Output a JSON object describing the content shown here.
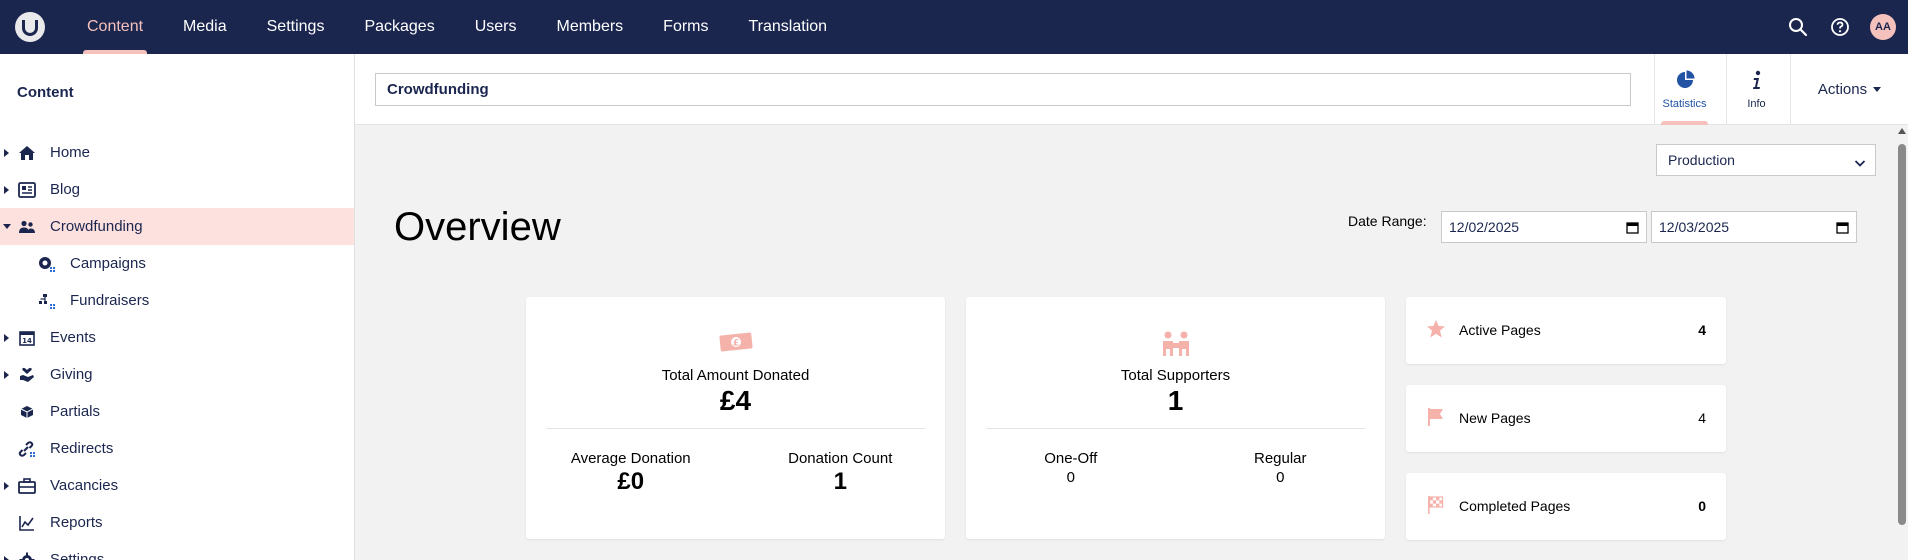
{
  "topbar": {
    "logo": "umbraco-logo",
    "nav": [
      {
        "label": "Content",
        "active": true
      },
      {
        "label": "Media"
      },
      {
        "label": "Settings"
      },
      {
        "label": "Packages"
      },
      {
        "label": "Users"
      },
      {
        "label": "Members"
      },
      {
        "label": "Forms"
      },
      {
        "label": "Translation"
      }
    ],
    "icons": [
      "search-icon",
      "help-icon"
    ],
    "avatar_initials": "AA"
  },
  "sidebar": {
    "title": "Content",
    "items": [
      {
        "label": "Home",
        "icon": "home-icon",
        "caret": "closed"
      },
      {
        "label": "Blog",
        "icon": "newspaper-icon",
        "caret": "closed"
      },
      {
        "label": "Crowdfunding",
        "icon": "people-icon",
        "caret": "open",
        "selected": true
      },
      {
        "label": "Campaigns",
        "icon": "campaign-icon",
        "child": true
      },
      {
        "label": "Fundraisers",
        "icon": "sitemap-icon",
        "child": true
      },
      {
        "label": "Events",
        "icon": "calendar-icon",
        "caret": "closed"
      },
      {
        "label": "Giving",
        "icon": "hand-heart-icon",
        "caret": "closed"
      },
      {
        "label": "Partials",
        "icon": "box-icon"
      },
      {
        "label": "Redirects",
        "icon": "link-icon"
      },
      {
        "label": "Vacancies",
        "icon": "briefcase-icon",
        "caret": "closed"
      },
      {
        "label": "Reports",
        "icon": "chart-icon"
      },
      {
        "label": "Settings",
        "icon": "gear-icon",
        "caret": "closed"
      }
    ]
  },
  "header": {
    "name_value": "Crowdfunding",
    "tabs": [
      {
        "label": "Statistics",
        "icon": "pie-chart-icon",
        "active": true
      },
      {
        "label": "Info",
        "icon": "info-icon"
      }
    ],
    "actions_label": "Actions"
  },
  "main": {
    "environment": "Production",
    "heading": "Overview",
    "date_range_label": "Date Range:",
    "date_from": "12/02/2025",
    "date_to": "12/03/2025",
    "cards": {
      "donated": {
        "label": "Total Amount Donated",
        "value": "£4",
        "left_label": "Average Donation",
        "left_value": "£0",
        "right_label": "Donation Count",
        "right_value": "1"
      },
      "supporters": {
        "label": "Total Supporters",
        "value": "1",
        "left_label": "One-Off",
        "left_value": "0",
        "right_label": "Regular",
        "right_value": "0"
      }
    },
    "stats": [
      {
        "label": "Active Pages",
        "value": "4",
        "icon": "star-icon"
      },
      {
        "label": "New Pages",
        "value": "4",
        "icon": "flag-icon"
      },
      {
        "label": "Completed Pages",
        "value": "0",
        "icon": "checkered-flag-icon"
      }
    ],
    "accent_color": "#f5c1bc",
    "navy_color": "#1b264f"
  }
}
